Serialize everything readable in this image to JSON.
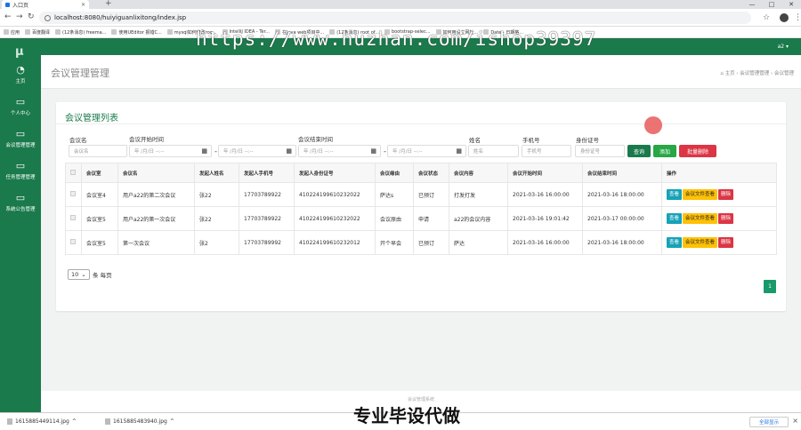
{
  "browser": {
    "tab_title": "入口页",
    "url": "localhost:8080/huiyiguanlixitong/index.jsp",
    "bookmarks": [
      "应用",
      "百度翻译",
      "(12条消息) freema...",
      "使用UEditor 报错C...",
      "mysql如何修改roo...",
      "IntelliJ IDEA - Ter...",
      "在Java web项目中...",
      "(12条消息) root of...",
      "bootstrap-selec...",
      "如何用设立网址...",
      "Date - 日期格..."
    ]
  },
  "watermark": "https://www.huzhan.com/ishop39397",
  "sidebar": {
    "logo": "μ",
    "items": [
      {
        "icon": "dashboard-icon",
        "label": "主页"
      },
      {
        "icon": "monitor-icon",
        "label": "个人中心"
      },
      {
        "icon": "monitor-icon",
        "label": "会议管理管理"
      },
      {
        "icon": "monitor-icon",
        "label": "任务管理管理"
      },
      {
        "icon": "monitor-icon",
        "label": "系统公告管理"
      }
    ]
  },
  "topbar": {
    "user": "a2 ▾"
  },
  "header": {
    "title": "会议管理管理",
    "breadcrumb": "⌂ 主页  ›  会议管理管理  ›  会议管理"
  },
  "card": {
    "title": "会议管理列表",
    "filters": {
      "name_label": "会议名",
      "name_placeholder": "会议名",
      "start_label": "会议开始时间",
      "end_label": "会议结束时间",
      "date_placeholder": "年 /月/日 --:--",
      "person_label": "姓名",
      "person_placeholder": "姓名",
      "phone_label": "手机号",
      "phone_placeholder": "手机号",
      "idcard_label": "身份证号",
      "idcard_placeholder": "身份证号",
      "dash": "-"
    },
    "buttons": {
      "query": "查询",
      "add": "添加",
      "batch_delete": "批量删除"
    },
    "table": {
      "headers": [
        "会议室",
        "会议名",
        "发起人姓名",
        "发起人手机号",
        "发起人身份证号",
        "会议缘由",
        "会议状态",
        "会议内容",
        "会议开始时间",
        "会议结束时间",
        "操作"
      ],
      "rows": [
        [
          "会议室4",
          "用户a22的第二次会议",
          "张22",
          "17703789922",
          "410224199610232022",
          "萨达s",
          "已预订",
          "打发打发",
          "2021-03-16 16:00:00",
          "2021-03-16 18:00:00"
        ],
        [
          "会议室5",
          "用户a22的第一次会议",
          "张22",
          "17703789922",
          "410224199610232022",
          "会议原由",
          "申请",
          "a22的会议内容",
          "2021-03-16 19:01:42",
          "2021-03-17 00:00:00"
        ],
        [
          "会议室5",
          "第一次会议",
          "张2",
          "17703789992",
          "410224199610232012",
          "开个早会",
          "已预订",
          "萨达",
          "2021-03-16 16:00:00",
          "2021-03-16 18:00:00"
        ]
      ],
      "actions": {
        "view": "查看",
        "file_view": "会议文件查看",
        "delete": "删除"
      }
    },
    "page_size": "10",
    "page_size_suffix": "条 每页",
    "page_number": "1"
  },
  "footer_text": "会议管理系统",
  "overlay_text": "专业毕设代做",
  "downloads": {
    "items": [
      "1615885449114.jpg",
      "1615885483940.jpg"
    ],
    "show_all": "全部显示"
  },
  "colors": {
    "primary": "#1a7a4c",
    "info": "#17a2b8",
    "warning": "#ffc107",
    "danger": "#dc3545",
    "success": "#28a745"
  }
}
